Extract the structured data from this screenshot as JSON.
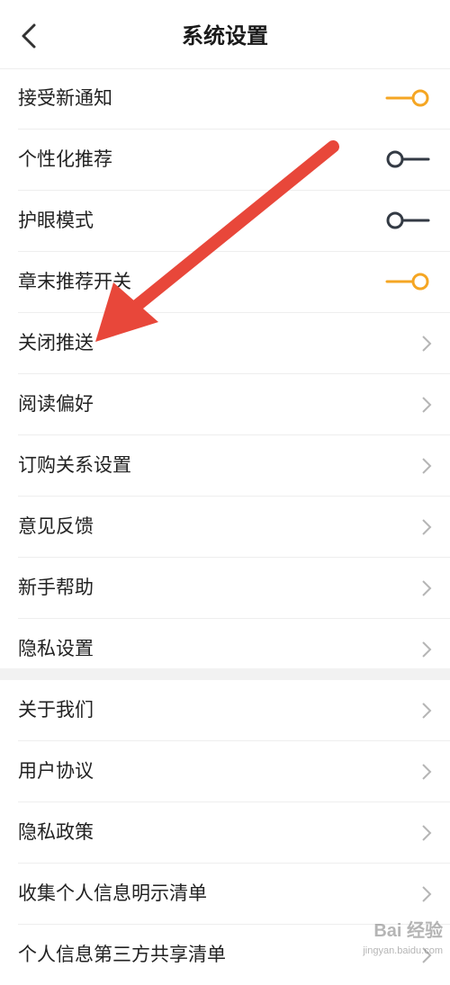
{
  "header": {
    "title": "系统设置",
    "back_icon": "back-chevron-icon"
  },
  "colors": {
    "toggle_on": "#f5a623",
    "toggle_off": "#333a44",
    "chevron": "#b5b5b5",
    "annotation_arrow": "#e8473a",
    "divider": "#eeeeee"
  },
  "settings": {
    "toggles": [
      {
        "label": "接受新通知",
        "on": true
      },
      {
        "label": "个性化推荐",
        "on": false
      },
      {
        "label": "护眼模式",
        "on": false
      },
      {
        "label": "章末推荐开关",
        "on": true
      }
    ],
    "links": [
      {
        "label": "关闭推送"
      },
      {
        "label": "阅读偏好"
      },
      {
        "label": "订购关系设置"
      },
      {
        "label": "意见反馈"
      },
      {
        "label": "新手帮助"
      },
      {
        "label": "隐私设置"
      }
    ]
  },
  "about": {
    "links": [
      {
        "label": "关于我们"
      },
      {
        "label": "用户协议"
      },
      {
        "label": "隐私政策"
      },
      {
        "label": "收集个人信息明示清单"
      },
      {
        "label": "个人信息第三方共享清单"
      }
    ]
  },
  "watermark": {
    "text": "Bai 经验",
    "sub": "jingyan.baidu.com"
  }
}
